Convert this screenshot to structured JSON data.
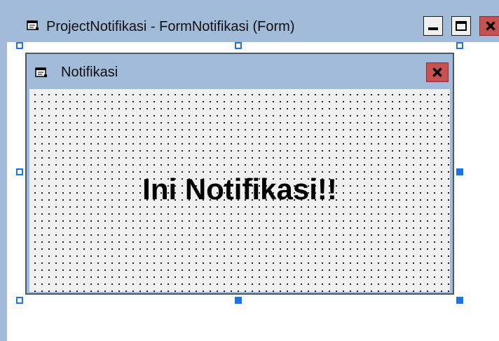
{
  "outer_window": {
    "title": "ProjectNotifikasi - FormNotifikasi (Form)",
    "icon": "form-icon",
    "controls": {
      "minimize": "minimize-icon",
      "maximize": "maximize-icon",
      "close": "close-icon"
    }
  },
  "inner_form": {
    "title": "Notifikasi",
    "icon": "form-icon",
    "close": "close-icon",
    "label_text": "Ini Notifikasi!!"
  },
  "colors": {
    "titlebar": "#a2bbd8",
    "close_button": "#c75050",
    "selection_handle": "#1a73e8",
    "form_background": "#f0f0f0"
  }
}
